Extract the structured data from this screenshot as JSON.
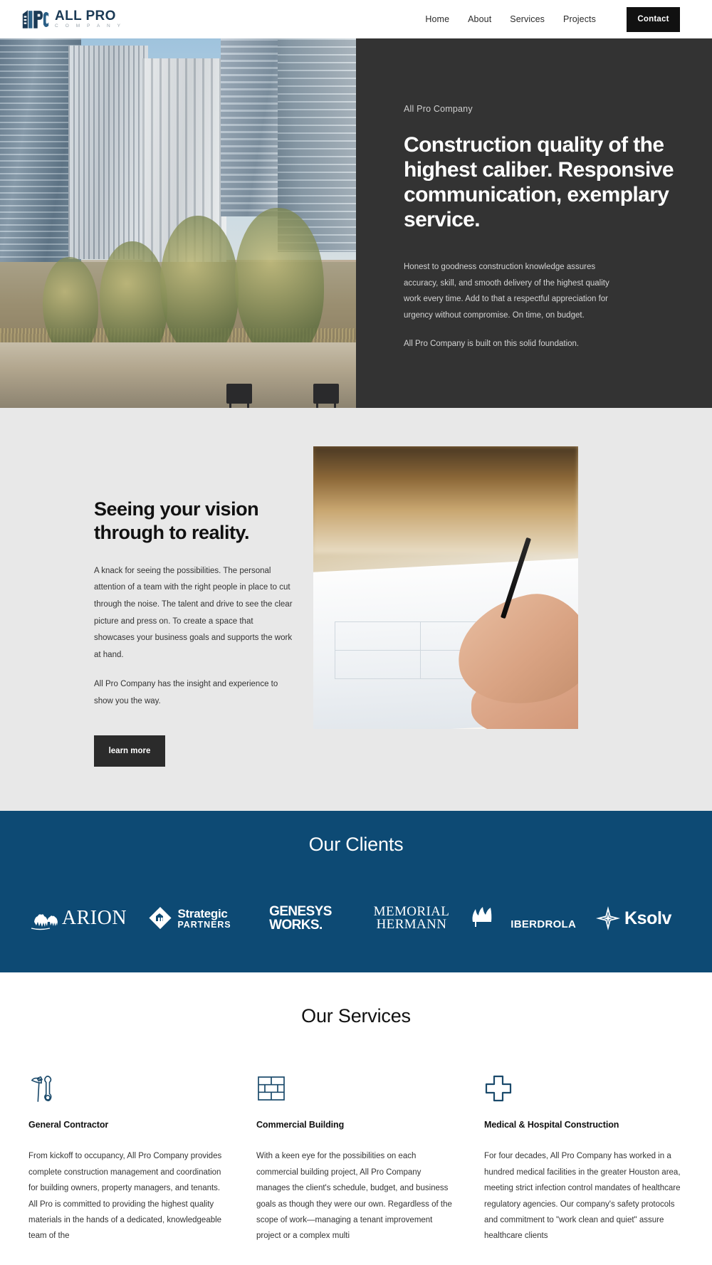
{
  "header": {
    "logo": {
      "mark_text": "APC",
      "main": "ALL PRO",
      "sub": "C O M P A N Y"
    },
    "nav": [
      {
        "label": "Home"
      },
      {
        "label": "About"
      },
      {
        "label": "Services"
      },
      {
        "label": "Projects"
      }
    ],
    "contact_button": "Contact"
  },
  "hero": {
    "eyebrow": "All Pro Company",
    "title": "Construction quality of the highest caliber. Responsive communication, exemplary service.",
    "paragraph_1": "Honest to goodness construction knowledge assures accuracy, skill, and smooth delivery of the highest quality work every time. Add to that a respectful appreciation for urgency without compromise. On time, on budget.",
    "paragraph_2": "All Pro Company is built on this solid foundation."
  },
  "vision": {
    "title": "Seeing your vision through to reality.",
    "paragraph_1": "A knack for seeing the possibilities. The personal attention of a team with the right people in place to cut through the noise. The talent and drive to see the clear picture and press on. To create a space that showcases your business goals and supports the work at hand.",
    "paragraph_2": "All Pro Company has the insight and experience to show you the way.",
    "button": "learn more"
  },
  "clients": {
    "heading": "Our Clients",
    "background_color": "#0d4a74",
    "logos": [
      {
        "name": "ARION",
        "icon": "arion-camels-icon"
      },
      {
        "name": "Strategic",
        "name2": "PARTNERS",
        "icon": "strategic-partners-diamond-icon"
      },
      {
        "name": "GENESYS",
        "name2": "WORKS.",
        "icon": "genesys-works-wordmark"
      },
      {
        "name": "MEMORIAL",
        "name2": "HERMANN",
        "icon": "memorial-hermann-wordmark"
      },
      {
        "name": "IBERDROLA",
        "icon": "iberdrola-flame-icon"
      },
      {
        "name": "Ksolv",
        "icon": "ksolv-star-icon"
      }
    ]
  },
  "services": {
    "heading": "Our Services",
    "accent_color": "#1b4a6b",
    "items": [
      {
        "icon": "hammer-wrench-icon",
        "title": "General Contractor",
        "body": "From kickoff to occupancy, All Pro Company provides complete construction management and coordination for building owners, property managers, and tenants. All Pro is committed to providing the highest quality materials in the hands of a dedicated, knowledgeable team of the"
      },
      {
        "icon": "brick-wall-icon",
        "title": "Commercial Building",
        "body": "With a keen eye for the possibilities on each commercial building project, All Pro Company manages the client's schedule, budget, and business goals as though they were our own. Regardless of the scope of work—managing a tenant improvement project or a complex multi"
      },
      {
        "icon": "medical-cross-icon",
        "title": "Medical & Hospital Construction",
        "body": "For four decades, All Pro Company has worked in a hundred medical facilities in the greater Houston area, meeting strict infection control mandates of healthcare regulatory agencies. Our company's safety protocols and commitment to \"work clean and quiet\" assure healthcare clients"
      }
    ]
  }
}
